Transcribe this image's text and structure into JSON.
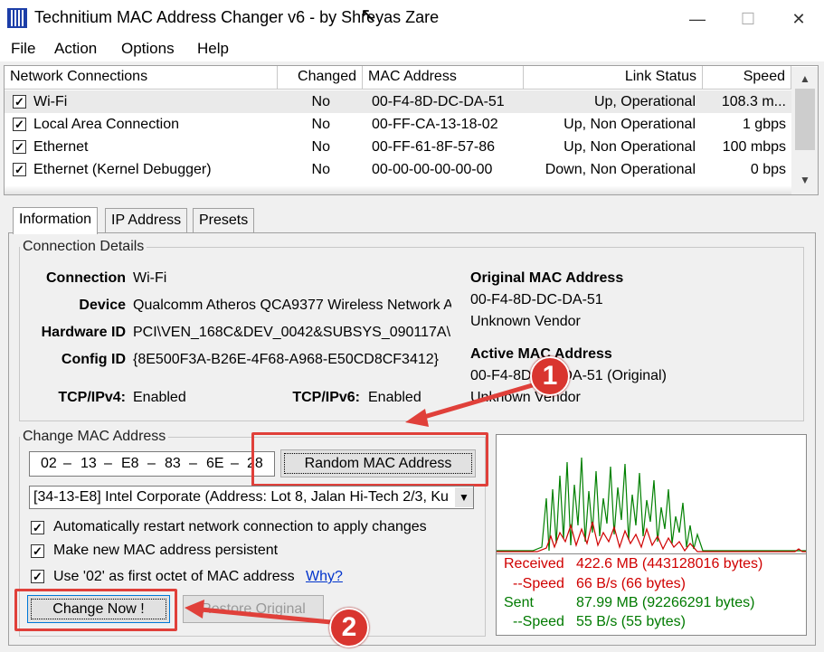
{
  "window": {
    "title": "Technitium MAC Address Changer v6 - by Shreyas Zare",
    "minimize": "—",
    "maximize": "☐",
    "close": "✕"
  },
  "menu": [
    "File",
    "Action",
    "Options",
    "Help"
  ],
  "list": {
    "headers": [
      "Network Connections",
      "Changed",
      "MAC Address",
      "Link Status",
      "Speed"
    ],
    "rows": [
      {
        "name": "Wi-Fi",
        "changed": "No",
        "mac": "00-F4-8D-DC-DA-51",
        "status": "Up, Operational",
        "speed": "108.3 m..."
      },
      {
        "name": "Local Area Connection",
        "changed": "No",
        "mac": "00-FF-CA-13-18-02",
        "status": "Up, Non Operational",
        "speed": "1 gbps"
      },
      {
        "name": "Ethernet",
        "changed": "No",
        "mac": "00-FF-61-8F-57-86",
        "status": "Up, Non Operational",
        "speed": "100 mbps"
      },
      {
        "name": "Ethernet (Kernel Debugger)",
        "changed": "No",
        "mac": "00-00-00-00-00-00",
        "status": "Down, Non Operational",
        "speed": "0 bps"
      }
    ]
  },
  "tabs": [
    "Information",
    "IP Address",
    "Presets"
  ],
  "details": {
    "group": "Connection Details",
    "connection_label": "Connection",
    "connection": "Wi-Fi",
    "device_label": "Device",
    "device": "Qualcomm Atheros QCA9377 Wireless Network A",
    "hwid_label": "Hardware ID",
    "hwid": "PCI\\VEN_168C&DEV_0042&SUBSYS_090117A\\",
    "config_label": "Config ID",
    "config": "{8E500F3A-B26E-4F68-A968-E50CD8CF3412}",
    "ipv4_label": "TCP/IPv4:",
    "ipv4": "Enabled",
    "ipv6_label": "TCP/IPv6:",
    "ipv6": "Enabled",
    "orig_title": "Original MAC Address",
    "orig_mac": "00-F4-8D-DC-DA-51",
    "orig_vendor": "Unknown Vendor",
    "active_title": "Active MAC Address",
    "active_mac": "00-F4-8D-DC-DA-51 (Original)",
    "active_vendor": "Unknown Vendor"
  },
  "change": {
    "group": "Change MAC Address",
    "octets": [
      "02",
      "13",
      "E8",
      "83",
      "6E",
      "28"
    ],
    "sep": "–",
    "random_button": "Random MAC Address",
    "vendor_select": "[34-13-E8] Intel Corporate  (Address: Lot 8, Jalan Hi-Tech 2/3, Ku",
    "opt1": "Automatically restart network connection to apply changes",
    "opt2": "Make new MAC address persistent",
    "opt3": "Use '02' as first octet of MAC address",
    "why": "Why?",
    "change_now": "Change Now !",
    "restore": "Restore Original"
  },
  "stats": {
    "received_label": "Received",
    "received": "422.6 MB (443128016 bytes)",
    "rspeed_label": "--Speed",
    "rspeed": "66 B/s (66 bytes)",
    "sent_label": "Sent",
    "sent": "87.99 MB (92266291 bytes)",
    "sspeed_label": "--Speed",
    "sspeed": "55 B/s (55 bytes)",
    "received_color": "#d00000",
    "sent_color": "#007a00"
  },
  "annotations": {
    "badge1": "1",
    "badge2": "2",
    "color": "#e0403a"
  }
}
